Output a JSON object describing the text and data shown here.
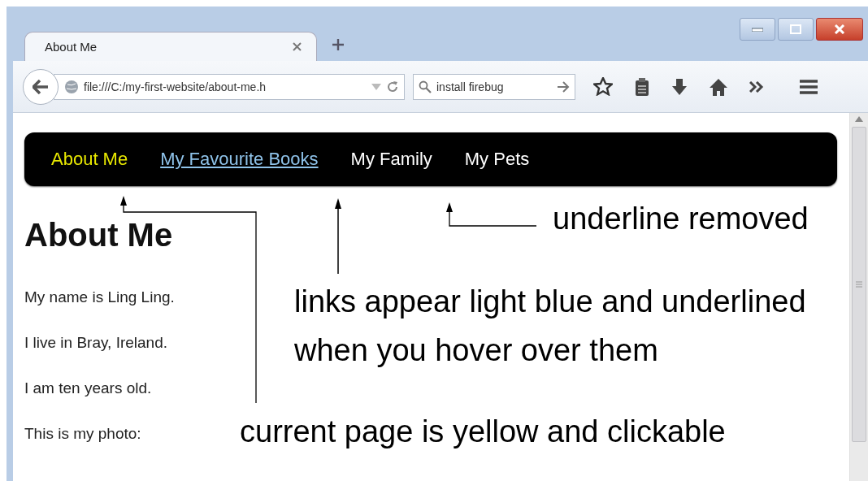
{
  "window": {
    "tabs": [
      {
        "label": "About Me",
        "selected": true
      }
    ]
  },
  "toolbar": {
    "address": {
      "value": "file:///C:/my-first-website/about-me.h"
    },
    "search": {
      "value": "install firebug"
    }
  },
  "page": {
    "nav": [
      {
        "label": "About Me",
        "selected": true,
        "hovered": false
      },
      {
        "label": "My Favourite Books",
        "selected": false,
        "hovered": true
      },
      {
        "label": "My Family",
        "selected": false,
        "hovered": false
      },
      {
        "label": "My Pets",
        "selected": false,
        "hovered": false
      }
    ],
    "heading": "About Me",
    "paragraphs": [
      "My name is Ling Ling.",
      "I live in Bray, Ireland.",
      "I am ten years old.",
      "This is my photo:"
    ]
  },
  "annotations": [
    {
      "text": "underline removed"
    },
    {
      "text": "links appear light blue and underlined"
    },
    {
      "text": "when you hover over them"
    },
    {
      "text": "current page is yellow and clickable"
    }
  ]
}
